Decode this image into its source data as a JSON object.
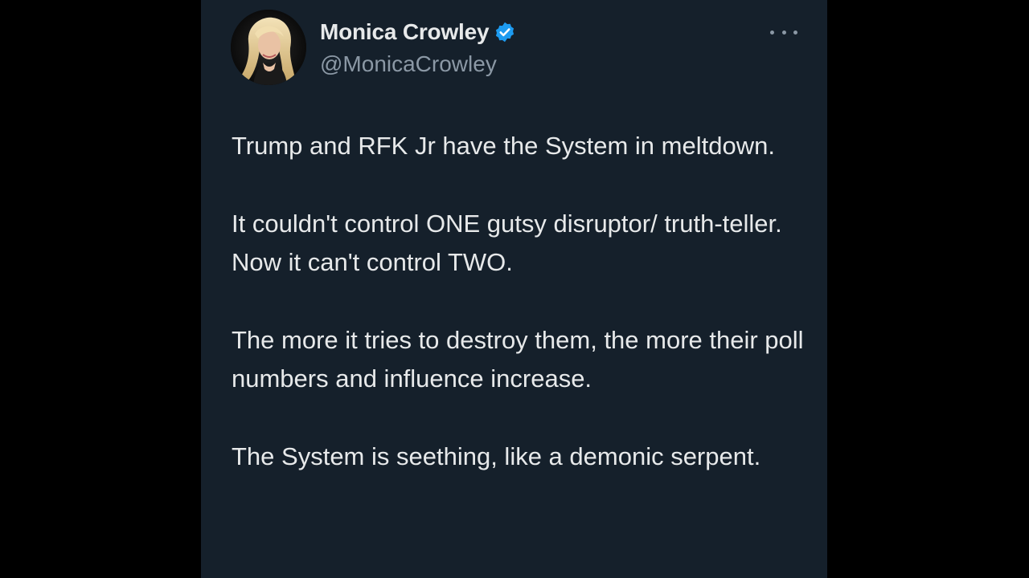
{
  "tweet": {
    "author": {
      "display_name": "Monica Crowley",
      "handle": "@MonicaCrowley",
      "verified": true,
      "verified_icon": "verified-badge-icon"
    },
    "menu_icon": "more-options-icon",
    "paragraphs": [
      "Trump and RFK Jr have the System in meltdown.",
      "It couldn't control ONE gutsy disruptor/ truth-teller.  Now it can't control TWO.",
      "The more it tries to destroy them, the more their poll numbers and influence increase.",
      "The System is seething, like a demonic serpent."
    ]
  },
  "colors": {
    "card_background": "#15202b",
    "page_background": "#000000",
    "primary_text": "#e7e9ea",
    "secondary_text": "#8b98a5",
    "verified_blue": "#1d9bf0"
  }
}
